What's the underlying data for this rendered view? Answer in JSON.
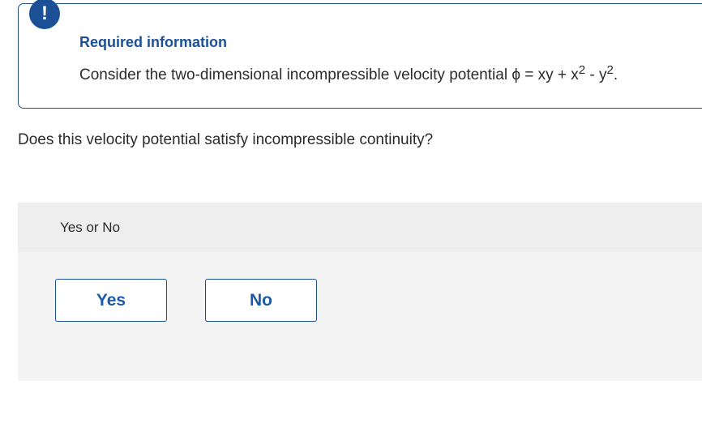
{
  "info": {
    "alert_glyph": "!",
    "title": "Required information",
    "statement_text": "Consider the two-dimensional incompressible velocity potential ϕ = xy + x",
    "exp1": "2",
    "minus_y": " - y",
    "exp2": "2",
    "period": "."
  },
  "question": {
    "text": "Does this velocity potential satisfy incompressible continuity?"
  },
  "answer": {
    "prompt": "Yes or No",
    "yes_label": "Yes",
    "no_label": "No"
  },
  "colors": {
    "accent": "#1b4f96",
    "panel_bg": "#f4f4f4",
    "header_bg": "#eeeeee"
  },
  "icons": {
    "alert": "exclamation-circle-icon"
  }
}
